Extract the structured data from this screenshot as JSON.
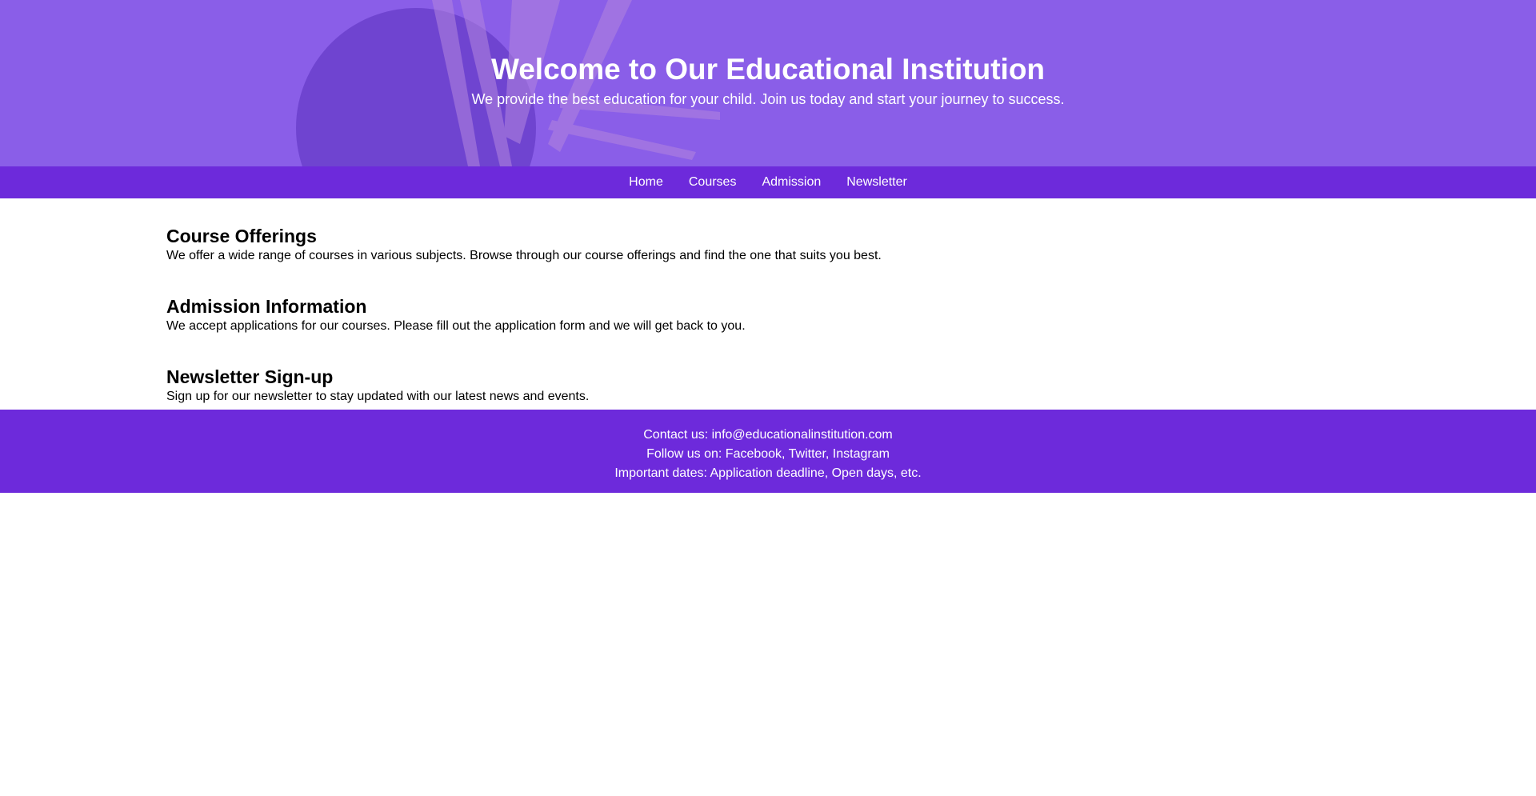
{
  "hero": {
    "title": "Welcome to Our Educational Institution",
    "subtitle": "We provide the best education for your child. Join us today and start your journey to success."
  },
  "nav": {
    "items": [
      {
        "label": "Home"
      },
      {
        "label": "Courses"
      },
      {
        "label": "Admission"
      },
      {
        "label": "Newsletter"
      }
    ]
  },
  "sections": [
    {
      "heading": "Course Offerings",
      "text": "We offer a wide range of courses in various subjects. Browse through our course offerings and find the one that suits you best."
    },
    {
      "heading": "Admission Information",
      "text": "We accept applications for our courses. Please fill out the application form and we will get back to you."
    },
    {
      "heading": "Newsletter Sign-up",
      "text": "Sign up for our newsletter to stay updated with our latest news and events."
    }
  ],
  "footer": {
    "contact": "Contact us: info@educationalinstitution.com",
    "social": "Follow us on: Facebook, Twitter, Instagram",
    "dates": "Important dates: Application deadline, Open days, etc."
  },
  "colors": {
    "hero_overlay": "#8a5ee8",
    "nav_bg": "#6d2adb",
    "footer_bg": "#6d2adb",
    "text_light": "#ffffff",
    "text_dark": "#000000"
  }
}
